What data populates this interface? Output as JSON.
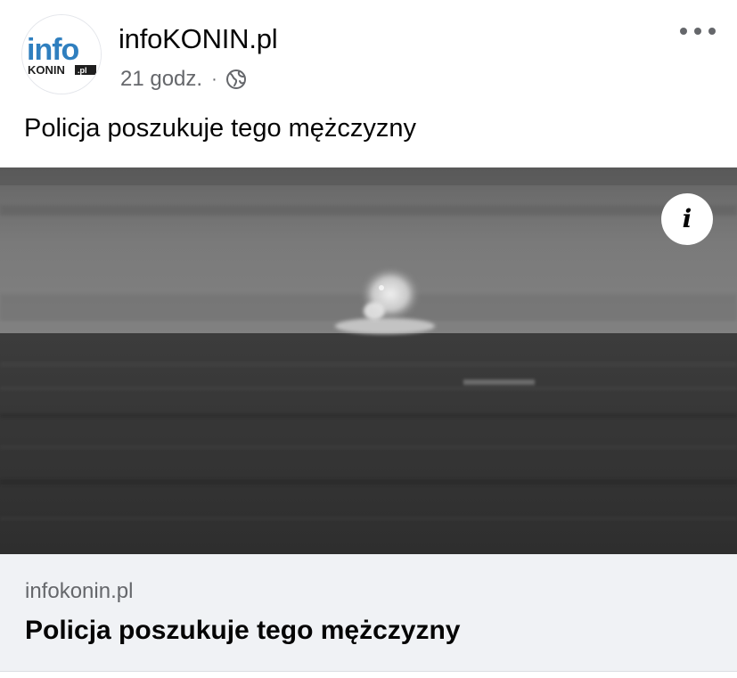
{
  "post": {
    "page_name": "infoKONIN.pl",
    "time": "21 godz.",
    "separator": "·",
    "audience_icon": "globe-icon",
    "more_icon": "more-horizontal-icon",
    "text": "Policja poszukuje tego mężczyzny"
  },
  "avatar": {
    "logo_text_top": "info",
    "logo_text_bottom": "KONIN",
    "logo_text_suffix": ".pl",
    "accent_color": "#2f7fbf"
  },
  "media": {
    "description_icon": "info-icon",
    "info_glyph": "i"
  },
  "link_card": {
    "domain": "infokonin.pl",
    "title": "Policja poszukuje tego mężczyzny"
  },
  "colors": {
    "primary_text": "#050505",
    "secondary_text": "#65676b",
    "card_background": "#f0f2f5"
  }
}
